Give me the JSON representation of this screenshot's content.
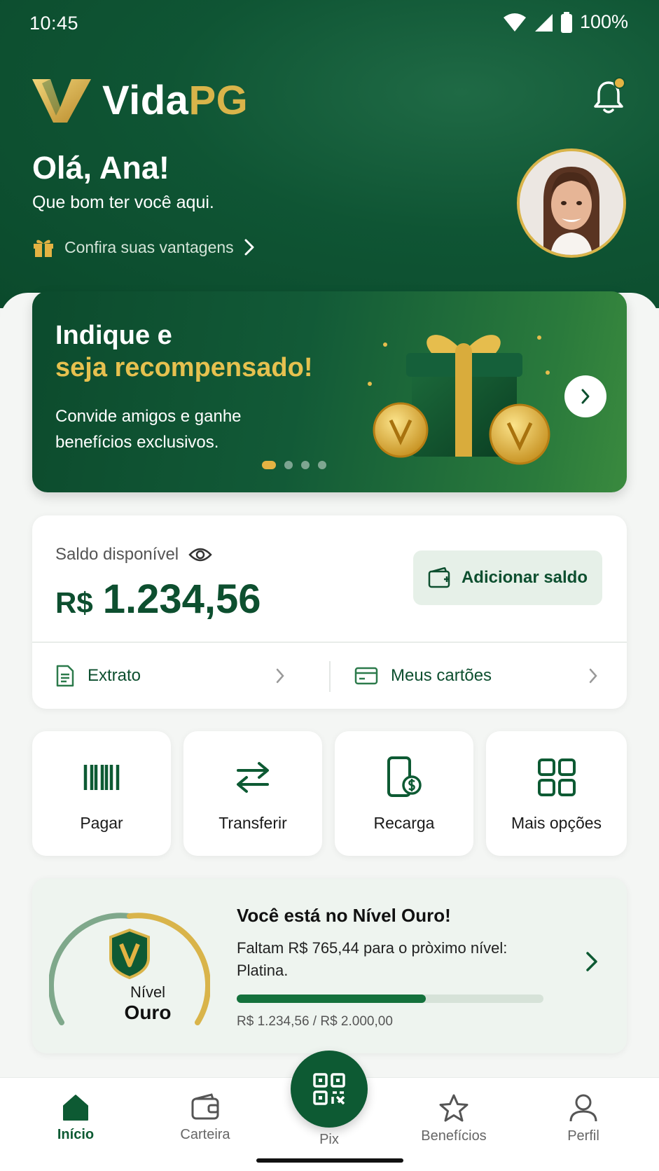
{
  "status_bar": {
    "time": "10:45",
    "battery": "100%"
  },
  "brand": {
    "name_part1": "Vida",
    "name_part2": "PG"
  },
  "header": {
    "greeting": "Olá, Ana!",
    "subgreeting": "Que bom ter você aqui.",
    "benefits_link": "Confira suas vantagens"
  },
  "banner": {
    "title_line1": "Indique e",
    "title_line2": "seja recompensado!",
    "description": "Convide amigos e ganhe benefícios exclusivos.",
    "active_slide": 1,
    "total_slides": 4
  },
  "balance": {
    "label": "Saldo disponível",
    "currency": "R$",
    "amount": "1.234,56",
    "add_button": "Adicionar saldo",
    "statement_link": "Extrato",
    "cards_link": "Meus cartões"
  },
  "quick_actions": [
    {
      "label": "Pagar",
      "icon": "barcode-icon"
    },
    {
      "label": "Transferir",
      "icon": "transfer-arrows-icon"
    },
    {
      "label": "Recarga",
      "icon": "phone-recharge-icon"
    },
    {
      "label": "Mais opções",
      "icon": "grid-icon"
    }
  ],
  "level": {
    "word": "Nível",
    "name": "Ouro",
    "title": "Você está no Nível Ouro!",
    "description": "Faltam R$ 765,44 para o pròximo nível: Platina.",
    "progress_fraction": 0.617,
    "progress_text": "R$ 1.234,56 / R$ 2.000,00"
  },
  "bottom_nav": {
    "items": [
      {
        "label": "Início",
        "icon": "home-icon",
        "active": true
      },
      {
        "label": "Carteira",
        "icon": "wallet-icon",
        "active": false
      },
      {
        "label": "Pix",
        "icon": "qr-code-icon",
        "active": false
      },
      {
        "label": "Benefícios",
        "icon": "star-icon",
        "active": false
      },
      {
        "label": "Perfil",
        "icon": "user-icon",
        "active": false
      }
    ]
  },
  "colors": {
    "brand_green": "#0d5a33",
    "gold": "#d9b44a",
    "header_green": "#0f5534"
  }
}
